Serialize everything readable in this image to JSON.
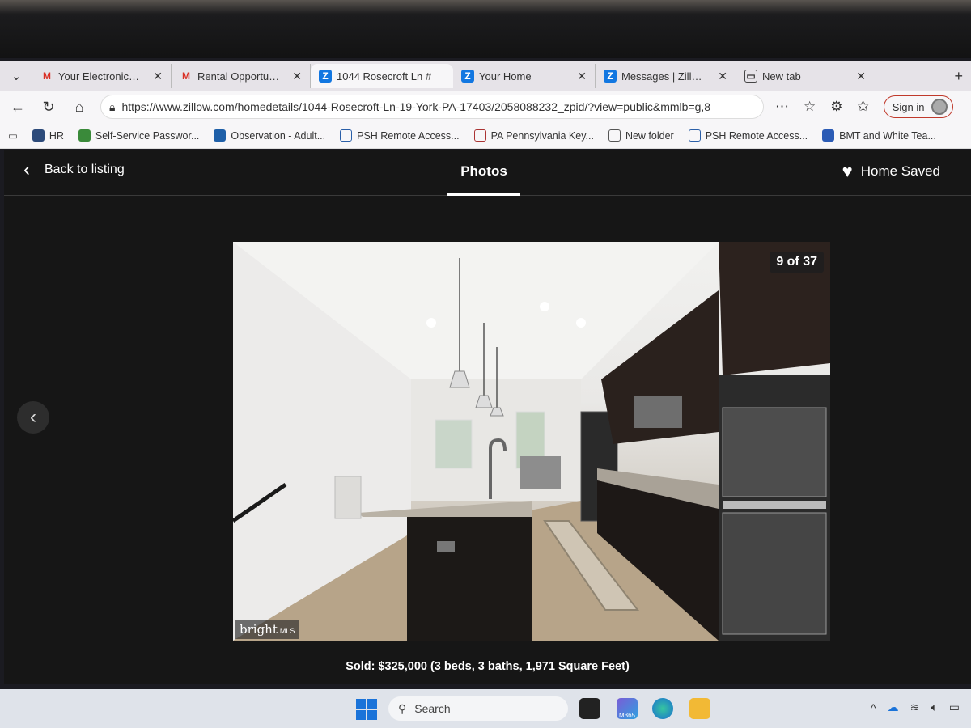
{
  "tabs": [
    {
      "label": "Your Electronic Rece",
      "icon": "gmail-icon"
    },
    {
      "label": "Rental Opportunity",
      "icon": "gmail-icon"
    },
    {
      "label": "1044 Rosecroft Ln #",
      "icon": "zillow-icon",
      "active": true
    },
    {
      "label": "Your Home",
      "icon": "zillow-icon"
    },
    {
      "label": "Messages | Zillow Re",
      "icon": "zillow-icon"
    },
    {
      "label": "New tab",
      "icon": "newtab-icon"
    }
  ],
  "address": {
    "url": "https://www.zillow.com/homedetails/1044-Rosecroft-Ln-19-York-PA-17403/2058088232_zpid/?view=public&mmlb=g,8",
    "signin_label": "Sign in"
  },
  "bookmarks": [
    {
      "label": "HR",
      "icon": "shield-icon"
    },
    {
      "label": "Self-Service Passwor...",
      "icon": "app-icon"
    },
    {
      "label": "Observation - Adult...",
      "icon": "app-icon"
    },
    {
      "label": "PSH Remote Access...",
      "icon": "lock-icon"
    },
    {
      "label": "PA Pennsylvania Key...",
      "icon": "pa-icon"
    },
    {
      "label": "New folder",
      "icon": "folder-icon"
    },
    {
      "label": "PSH Remote Access...",
      "icon": "lock-icon"
    },
    {
      "label": "BMT and White Tea...",
      "icon": "app-icon"
    }
  ],
  "viewer": {
    "back_label": "Back to listing",
    "title": "Photos",
    "saved_label": "Home Saved",
    "counter": "9 of 37",
    "watermark": "bright",
    "watermark_suffix": "MLS",
    "caption": "Sold: $325,000 (3 beds, 3 baths, 1,971 Square Feet)"
  },
  "taskbar": {
    "search_placeholder": "Search",
    "app_badge": "M365"
  },
  "colors": {
    "viewer_bg": "#161616",
    "zillow_blue": "#1277e1",
    "gmail_red": "#d93025",
    "signin_border": "#c0392b"
  }
}
